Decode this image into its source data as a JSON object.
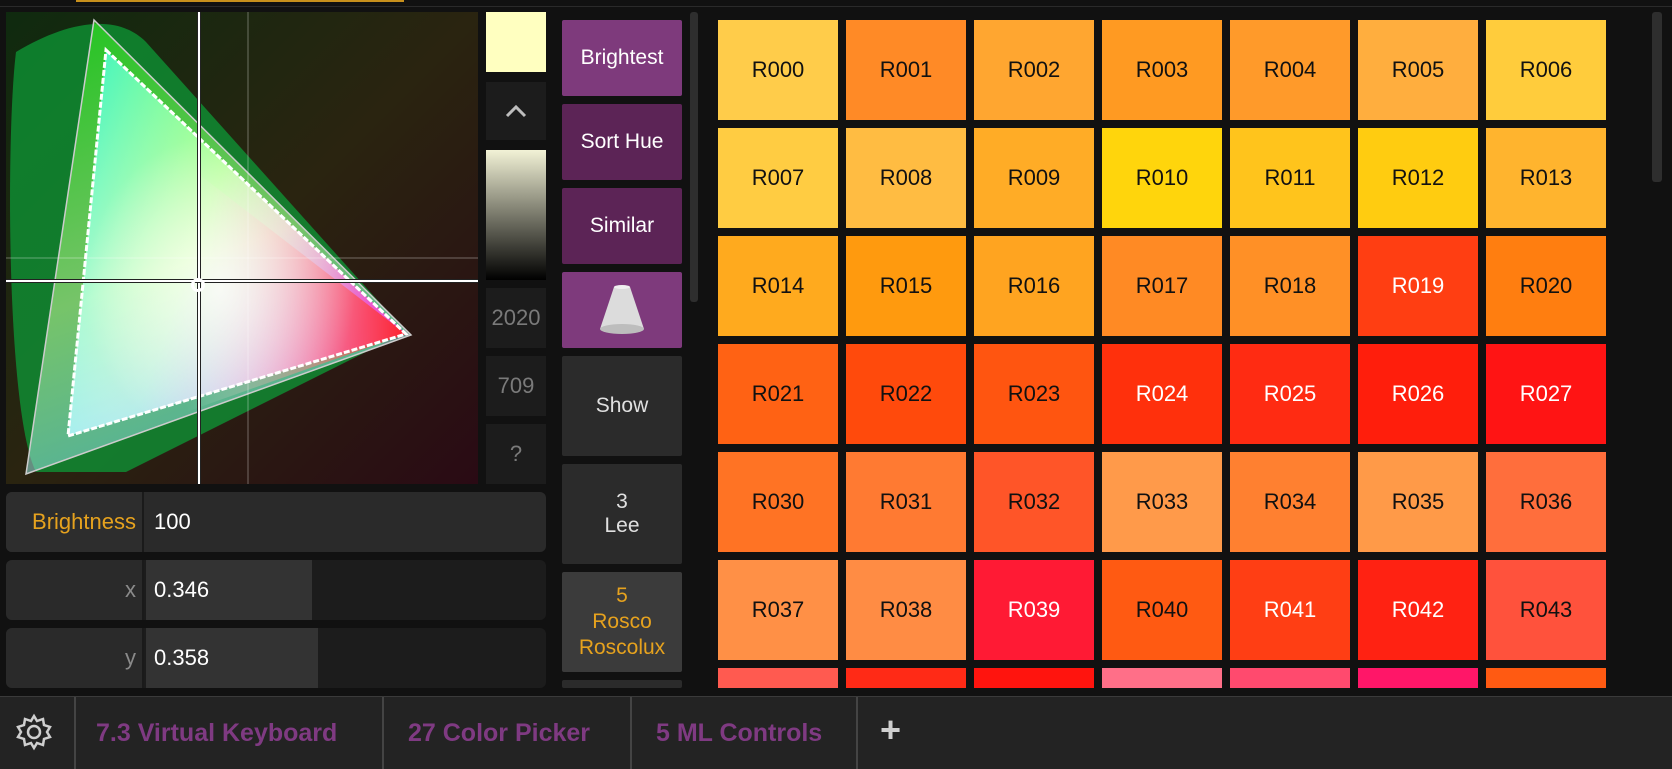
{
  "colors": {
    "accent": "#c8901c",
    "purple": "#7e3a7c",
    "tab_text": "#7f3a82",
    "label_gold": "#e6a21e"
  },
  "side": {
    "up_icon": "chevron-up-icon",
    "btn_2020": "2020",
    "btn_709": "709",
    "btn_help": "?"
  },
  "fields": {
    "brightness": {
      "label": "Brightness",
      "value": "100"
    },
    "x": {
      "label": "x",
      "value": "0.346",
      "fill": 0.28
    },
    "y": {
      "label": "y",
      "value": "0.358",
      "fill": 0.29
    }
  },
  "actions": {
    "brightest": "Brightest",
    "sort_hue": "Sort Hue",
    "similar": "Similar",
    "beam_icon": "beam-cone-icon",
    "show": "Show",
    "lee": [
      "3",
      "Lee"
    ],
    "rosco": [
      "5",
      "Rosco",
      "Roscolux"
    ]
  },
  "swatches": [
    {
      "code": "R000",
      "color": "#ffcc4a"
    },
    {
      "code": "R001",
      "color": "#ff8a26"
    },
    {
      "code": "R002",
      "color": "#ffa630"
    },
    {
      "code": "R003",
      "color": "#ff9a22"
    },
    {
      "code": "R004",
      "color": "#ff9a2a"
    },
    {
      "code": "R005",
      "color": "#ffae3e"
    },
    {
      "code": "R006",
      "color": "#ffcc3c"
    },
    {
      "code": "R007",
      "color": "#ffcc42"
    },
    {
      "code": "R008",
      "color": "#ffbc42"
    },
    {
      "code": "R009",
      "color": "#ffac26"
    },
    {
      "code": "R010",
      "color": "#ffd50c"
    },
    {
      "code": "R011",
      "color": "#ffc41c"
    },
    {
      "code": "R012",
      "color": "#ffcc10"
    },
    {
      "code": "R013",
      "color": "#ffb42e"
    },
    {
      "code": "R014",
      "color": "#ffaa1e"
    },
    {
      "code": "R015",
      "color": "#ff9a0e"
    },
    {
      "code": "R016",
      "color": "#ffa420"
    },
    {
      "code": "R017",
      "color": "#ff8a24"
    },
    {
      "code": "R018",
      "color": "#ff9026"
    },
    {
      "code": "R019",
      "color": "#ff3e12"
    },
    {
      "code": "R020",
      "color": "#ff7e10"
    },
    {
      "code": "R021",
      "color": "#ff6214"
    },
    {
      "code": "R022",
      "color": "#ff4a0c"
    },
    {
      "code": "R023",
      "color": "#ff5510"
    },
    {
      "code": "R024",
      "color": "#ff300c"
    },
    {
      "code": "R025",
      "color": "#ff2b12"
    },
    {
      "code": "R026",
      "color": "#ff1e0c"
    },
    {
      "code": "R027",
      "color": "#ff1414"
    },
    {
      "code": "R030",
      "color": "#ff7324"
    },
    {
      "code": "R031",
      "color": "#ff7a32"
    },
    {
      "code": "R032",
      "color": "#ff5528"
    },
    {
      "code": "R033",
      "color": "#ff9a4a"
    },
    {
      "code": "R034",
      "color": "#ff8030"
    },
    {
      "code": "R035",
      "color": "#ff9a48"
    },
    {
      "code": "R036",
      "color": "#ff6e3c"
    },
    {
      "code": "R037",
      "color": "#ff9046"
    },
    {
      "code": "R038",
      "color": "#ff8c44"
    },
    {
      "code": "R039",
      "color": "#ff1a34"
    },
    {
      "code": "R040",
      "color": "#ff5a12"
    },
    {
      "code": "R041",
      "color": "#ff3e14"
    },
    {
      "code": "R042",
      "color": "#ff2212"
    },
    {
      "code": "R043",
      "color": "#ff523c"
    },
    {
      "code": "",
      "color": "#ff5a50"
    },
    {
      "code": "",
      "color": "#ff2a16"
    },
    {
      "code": "",
      "color": "#ff140e"
    },
    {
      "code": "",
      "color": "#ff6f88"
    },
    {
      "code": "",
      "color": "#ff4a6e"
    },
    {
      "code": "",
      "color": "#ff1668"
    },
    {
      "code": "",
      "color": "#ff5a12"
    }
  ],
  "tabs": [
    {
      "label": "7.3 Virtual Keyboard"
    },
    {
      "label": "27 Color Picker"
    },
    {
      "label": "5 ML Controls"
    }
  ],
  "bottom": {
    "settings_icon": "gear-icon",
    "add_icon": "plus-icon",
    "add_label": "+"
  }
}
